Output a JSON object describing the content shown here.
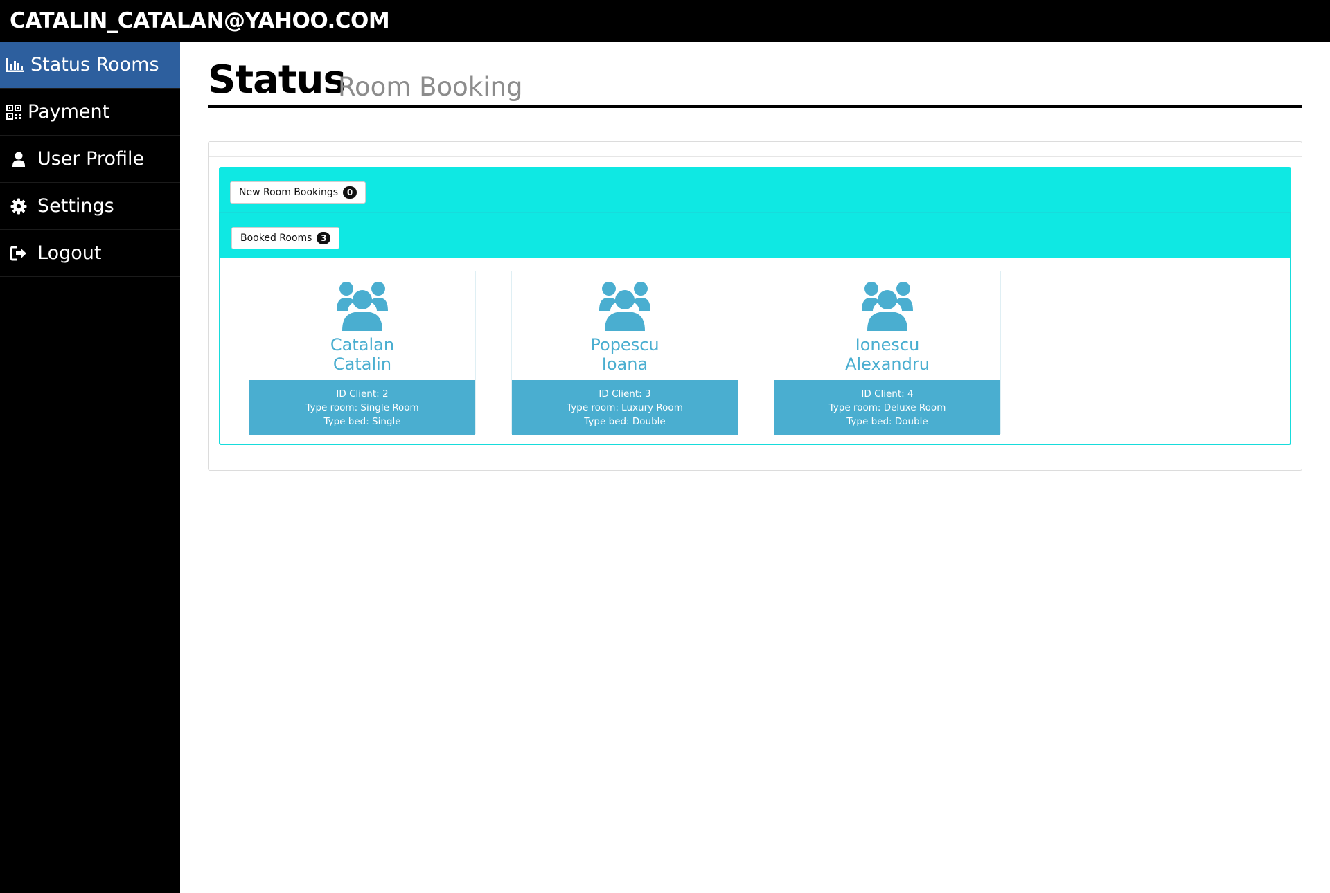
{
  "header": {
    "user_email": "CATALIN_CATALAN@YAHOO.COM"
  },
  "sidebar": {
    "items": [
      {
        "label": "Status Rooms",
        "icon": "bar-chart-icon",
        "active": true
      },
      {
        "label": "Payment",
        "icon": "qr-code-icon",
        "active": false
      },
      {
        "label": "User Profile",
        "icon": "user-icon",
        "active": false
      },
      {
        "label": "Settings",
        "icon": "gear-icon",
        "active": false
      },
      {
        "label": "Logout",
        "icon": "sign-out-icon",
        "active": false
      }
    ]
  },
  "page": {
    "title": "Status",
    "subtitle": "Room Booking"
  },
  "panels": {
    "new_bookings": {
      "label": "New Room Bookings",
      "count": "0"
    },
    "booked_rooms": {
      "label": "Booked Rooms",
      "count": "3"
    }
  },
  "rooms": [
    {
      "first": "Catalan",
      "last": "Catalin",
      "id": "ID Client: 2",
      "type_room": "Type room: Single Room",
      "type_bed": "Type bed: Single",
      "icon": "users-icon"
    },
    {
      "first": "Popescu",
      "last": "Ioana",
      "id": "ID Client: 3",
      "type_room": "Type room: Luxury Room",
      "type_bed": "Type bed: Double",
      "icon": "users-icon"
    },
    {
      "first": "Ionescu",
      "last": "Alexandru",
      "id": "ID Client: 4",
      "type_room": "Type room: Deluxe Room",
      "type_bed": "Type bed: Double",
      "icon": "users-icon"
    }
  ],
  "colors": {
    "topbar": "#000000",
    "sidebar_active": "#2d5f9e",
    "cyan": "#0fe8e3",
    "card_accent": "#4aaed0"
  }
}
